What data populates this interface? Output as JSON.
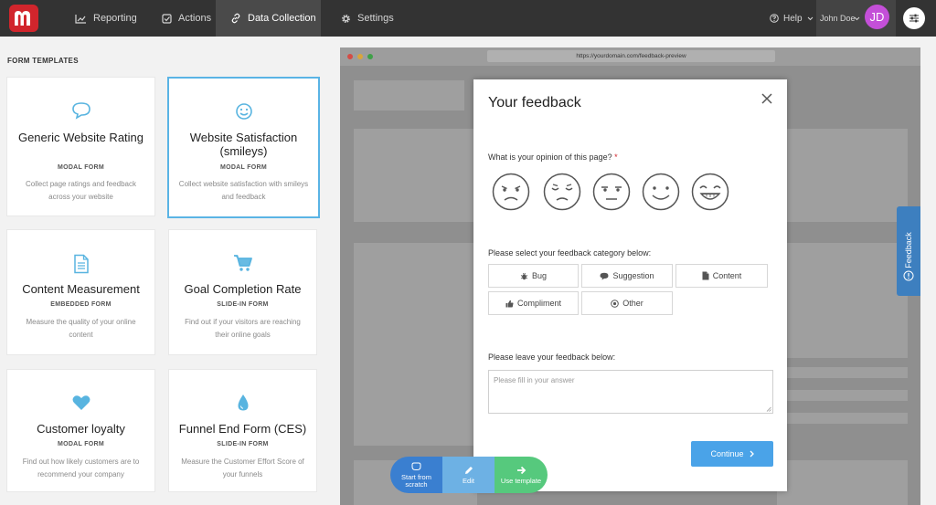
{
  "nav": {
    "items": [
      {
        "label": "Reporting"
      },
      {
        "label": "Actions"
      },
      {
        "label": "Data Collection"
      },
      {
        "label": "Settings"
      }
    ],
    "help": "Help",
    "user_name": "John Doe",
    "avatar_initials": "JD",
    "accent": "#d1252c"
  },
  "templates": {
    "title": "FORM TEMPLATES",
    "cards": [
      {
        "title": "Generic Website Rating",
        "type": "MODAL FORM",
        "desc": "Collect page ratings and feedback across your website",
        "icon": "speech-bubble-icon"
      },
      {
        "title": "Website Satisfaction (smileys)",
        "type": "MODAL FORM",
        "desc": "Collect website satisfaction with smileys and feedback",
        "icon": "smiley-icon"
      },
      {
        "title": "Content Measurement",
        "type": "EMBEDDED FORM",
        "desc": "Measure the quality of your online content",
        "icon": "document-icon"
      },
      {
        "title": "Goal Completion Rate",
        "type": "SLIDE-IN FORM",
        "desc": "Find out if your visitors are reaching their online goals",
        "icon": "cart-icon"
      },
      {
        "title": "Customer loyalty",
        "type": "MODAL FORM",
        "desc": "Find out how likely customers are to recommend your company",
        "icon": "heart-icon"
      },
      {
        "title": "Funnel End Form (CES)",
        "type": "SLIDE-IN FORM",
        "desc": "Measure the Customer Effort Score of your funnels",
        "icon": "drop-icon"
      }
    ]
  },
  "preview": {
    "url": "https://yourdomain.com/feedback-preview",
    "modal": {
      "title": "Your feedback",
      "question1": "What is your opinion of this page?",
      "required_mark": "*",
      "question2": "Please select your feedback category below:",
      "categories": [
        "Bug",
        "Suggestion",
        "Content",
        "Compliment",
        "Other"
      ],
      "question3": "Please leave your feedback below:",
      "placeholder": "Please fill in your answer",
      "continue": "Continue"
    },
    "side_tab": "Feedback"
  },
  "actions": {
    "start": "Start from scratch",
    "edit": "Edit",
    "use": "Use template"
  }
}
